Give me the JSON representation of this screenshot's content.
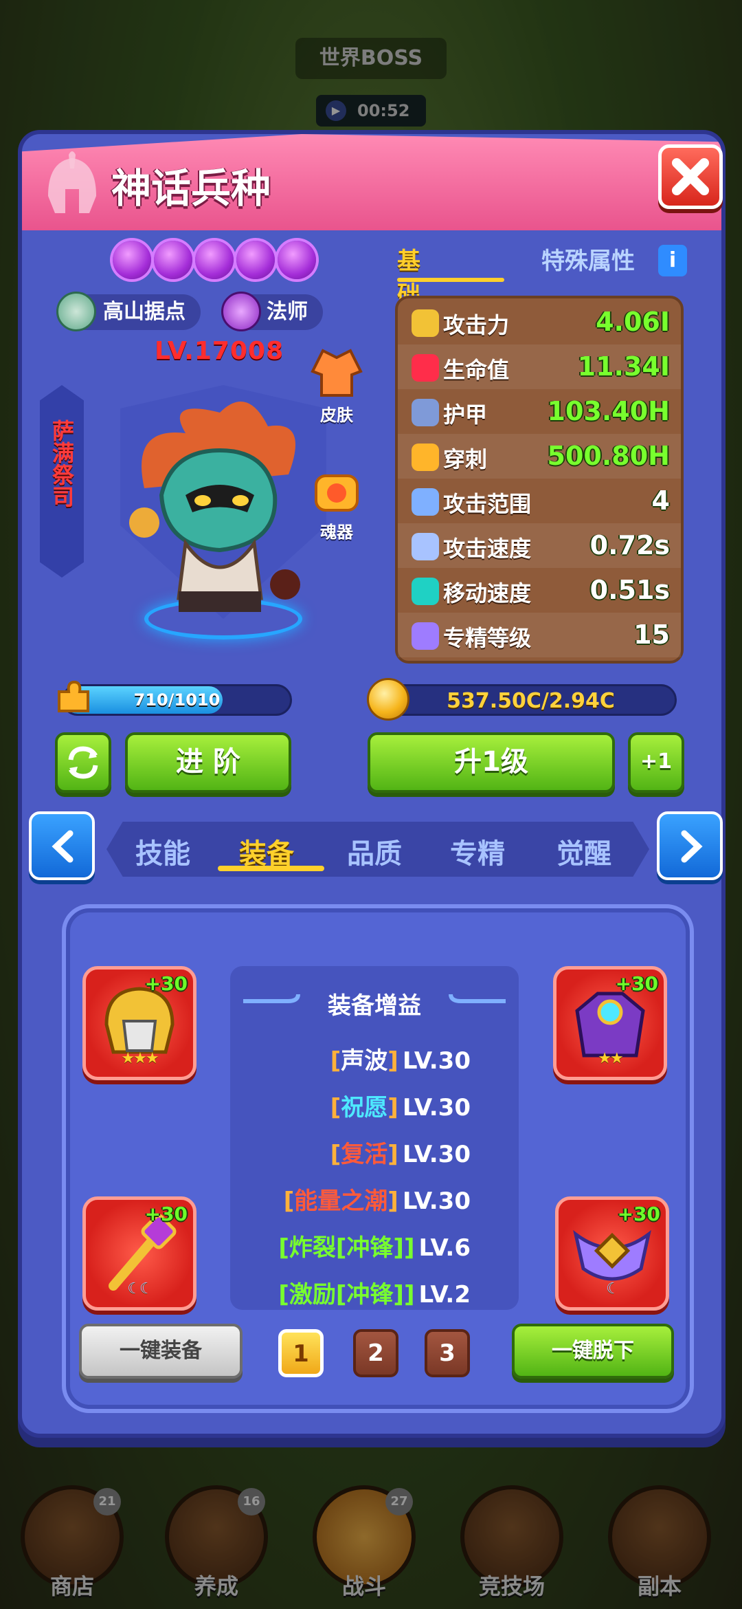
{
  "background": {
    "world_boss": "世界BOSS",
    "timer": "00:52",
    "nav": [
      {
        "label": "商店",
        "badge": "21"
      },
      {
        "label": "养成",
        "badge": "16"
      },
      {
        "label": "战斗",
        "badge": "27"
      },
      {
        "label": "竞技场",
        "badge": ""
      },
      {
        "label": "副本",
        "badge": ""
      }
    ]
  },
  "dialog": {
    "title": "神话兵种",
    "close_icon": "close-icon"
  },
  "hero": {
    "star_count": 5,
    "tags": [
      {
        "icon": "highland-icon",
        "label": "高山据点"
      },
      {
        "icon": "mage-staff-icon",
        "label": "法师"
      }
    ],
    "level": "LV.17008",
    "vertical_name": "萨满祭司",
    "skin_label": "皮肤",
    "soul_label": "魂器"
  },
  "attr_tabs": {
    "basic": "基础属性",
    "special": "特殊属性",
    "info": "i"
  },
  "stats": [
    {
      "icon": "sword-icon",
      "name": "攻击力",
      "value": "4.06I",
      "color": "#78ff2e"
    },
    {
      "icon": "heart-icon",
      "name": "生命值",
      "value": "11.34I",
      "color": "#78ff2e"
    },
    {
      "icon": "shield-icon",
      "name": "护甲",
      "value": "103.40H",
      "color": "#78ff2e"
    },
    {
      "icon": "pierce-icon",
      "name": "穿刺",
      "value": "500.80H",
      "color": "#78ff2e"
    },
    {
      "icon": "crosshair-icon",
      "name": "攻击范围",
      "value": "4",
      "color": "#ffffff"
    },
    {
      "icon": "attack-speed-icon",
      "name": "攻击速度",
      "value": "0.72s",
      "color": "#ffffff"
    },
    {
      "icon": "boot-icon",
      "name": "移动速度",
      "value": "0.51s",
      "color": "#ffffff"
    },
    {
      "icon": "gem-icon",
      "name": "专精等级",
      "value": "15",
      "color": "#ffffff"
    }
  ],
  "progress": {
    "xp_text": "710/1010",
    "xp_fraction": 0.703,
    "gold_text": "537.50C/2.94C"
  },
  "buttons": {
    "advance": "进 阶",
    "level_up": "升1级",
    "plus_one": "+1",
    "equip_all": "一键装备",
    "unequip_all": "一键脱下"
  },
  "section_tabs": [
    {
      "label": "技能",
      "active": false
    },
    {
      "label": "装备",
      "active": true
    },
    {
      "label": "品质",
      "active": false
    },
    {
      "label": "专精",
      "active": false
    },
    {
      "label": "觉醒",
      "active": false
    }
  ],
  "equipment": {
    "slots": [
      {
        "name": "helmet-icon",
        "plus": "+30",
        "stars": "★★★"
      },
      {
        "name": "armor-icon",
        "plus": "+30",
        "stars": "★★"
      },
      {
        "name": "staff-icon",
        "plus": "+30",
        "stars": "☾☾"
      },
      {
        "name": "amulet-icon",
        "plus": "+30",
        "stars": "☾"
      }
    ],
    "bonus_title": "装备增益",
    "bonuses": [
      {
        "open": "[",
        "skill": "声波",
        "close": "]",
        "lv": "LV.30",
        "color": "#ffffff",
        "bracket_color": "#ffb13b"
      },
      {
        "open": "[",
        "skill": "祝愿",
        "close": "]",
        "lv": "LV.30",
        "color": "#4ee8ff",
        "bracket_color": "#ffb13b"
      },
      {
        "open": "[",
        "skill": "复活",
        "close": "]",
        "lv": "LV.30",
        "color": "#ff5a3a",
        "bracket_color": "#ffb13b"
      },
      {
        "open": "[",
        "skill": "能量之潮",
        "close": "]",
        "lv": "LV.30",
        "color": "#ff5a3a",
        "bracket_color": "#ffb13b"
      },
      {
        "open": "[",
        "skill": "炸裂[冲锋]",
        "close": "]",
        "lv": "LV.6",
        "color": "#78ff2e",
        "bracket_color": "#78ff2e"
      },
      {
        "open": "[",
        "skill": "激励[冲锋]",
        "close": "]",
        "lv": "LV.2",
        "color": "#78ff2e",
        "bracket_color": "#78ff2e"
      }
    ],
    "pages": [
      "1",
      "2",
      "3"
    ],
    "active_page": "1"
  },
  "colors": {
    "dialog_bg": "#4c5ac4",
    "header_pink": "#e9548d",
    "gold": "#ffd12b",
    "green_value": "#78ff2e"
  }
}
